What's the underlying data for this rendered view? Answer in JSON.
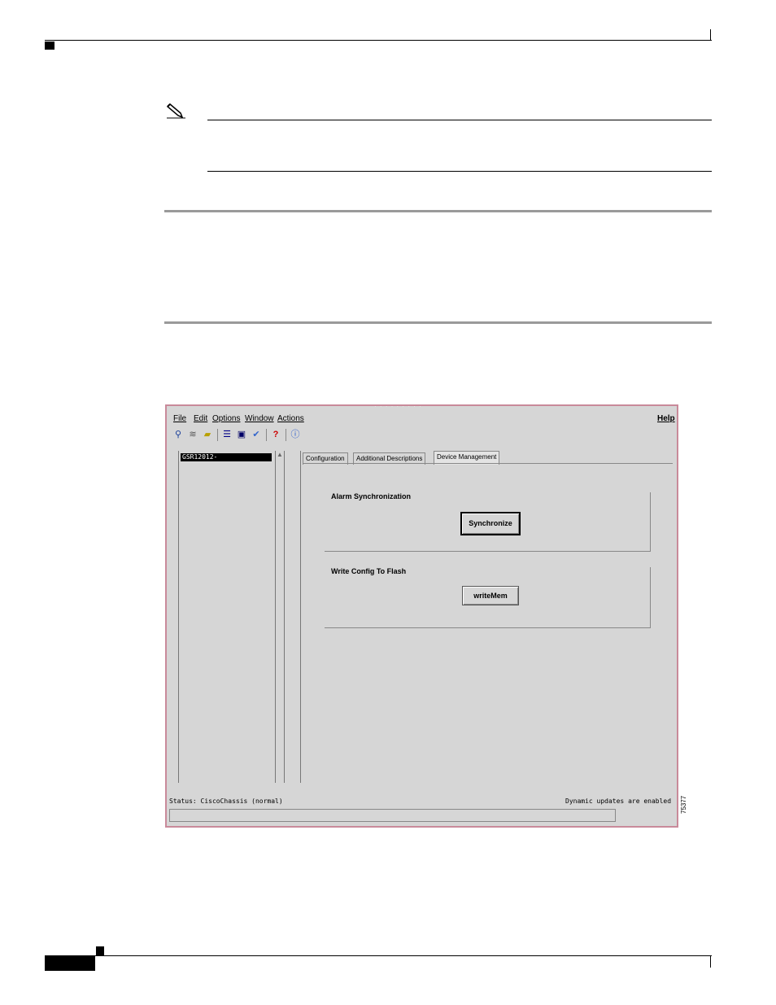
{
  "window": {
    "title_blur": "· · · · · · · · ·",
    "menus": {
      "file": "File",
      "edit": "Edit",
      "options": "Options",
      "window": "Window",
      "actions": "Actions",
      "help": "Help"
    },
    "toolbar_icons": [
      "tree-icon",
      "layers-icon",
      "folder-icon",
      "list-icon",
      "monitor-icon",
      "check-icon",
      "help-icon",
      "info-icon"
    ],
    "tree": {
      "selected_item": "GSR12012-"
    },
    "tabs": {
      "configuration": "Configuration",
      "additional_descriptions": "Additional Descriptions",
      "device_management": "Device Management",
      "active": "Device Management"
    },
    "alarm_group": {
      "title": "Alarm Synchronization",
      "button": "Synchronize"
    },
    "write_group": {
      "title": "Write Config To Flash",
      "button": "writeMem"
    },
    "status": {
      "left": "Status: CiscoChassis (normal)",
      "right": "Dynamic updates are enabled"
    }
  },
  "figure_id": "75377"
}
